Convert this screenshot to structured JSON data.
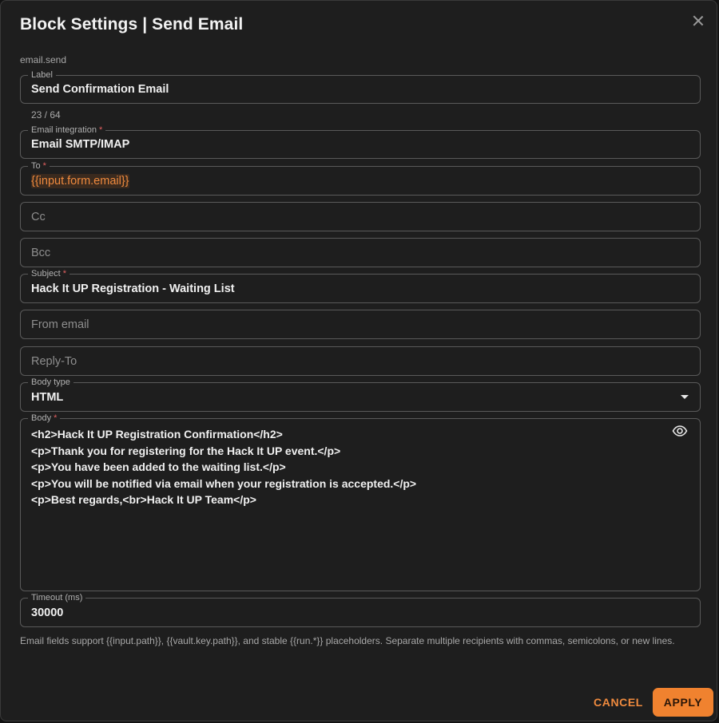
{
  "dialog": {
    "title": "Block Settings | Send Email",
    "block_type": "email.send"
  },
  "fields": {
    "label": {
      "legend": "Label",
      "value": "Send Confirmation Email",
      "counter": "23 / 64"
    },
    "integration": {
      "legend": "Email integration",
      "required_mark": "*",
      "value": "Email SMTP/IMAP"
    },
    "to": {
      "legend": "To",
      "required_mark": "*",
      "value": "{{input.form.email}}"
    },
    "cc": {
      "placeholder": "Cc"
    },
    "bcc": {
      "placeholder": "Bcc"
    },
    "subject": {
      "legend": "Subject",
      "required_mark": "*",
      "value": "Hack It UP Registration - Waiting List"
    },
    "from_email": {
      "placeholder": "From email"
    },
    "reply_to": {
      "placeholder": "Reply-To"
    },
    "body_type": {
      "legend": "Body type",
      "value": "HTML"
    },
    "body": {
      "legend": "Body",
      "required_mark": "*",
      "lines": [
        "<h2>Hack It UP Registration Confirmation</h2>",
        "<p>Thank you for registering for the Hack It UP event.</p>",
        "<p>You have been added to the waiting list.</p>",
        "<p>You will be notified via email when your registration is accepted.</p>",
        "<p>Best regards,<br>Hack It UP Team</p>"
      ]
    },
    "timeout": {
      "legend": "Timeout (ms)",
      "value": "30000"
    }
  },
  "helper_text": "Email fields support {{input.path}}, {{vault.key.path}}, and stable {{run.*}} placeholders. Separate multiple recipients with commas, semicolons, or new lines.",
  "actions": {
    "cancel": "CANCEL",
    "apply": "APPLY"
  },
  "icons": {
    "close": "close-icon",
    "eye": "eye-icon",
    "dropdown": "chevron-down-icon"
  },
  "colors": {
    "accent": "#f0822f",
    "required": "#e06060",
    "background": "#1e1e1e"
  }
}
